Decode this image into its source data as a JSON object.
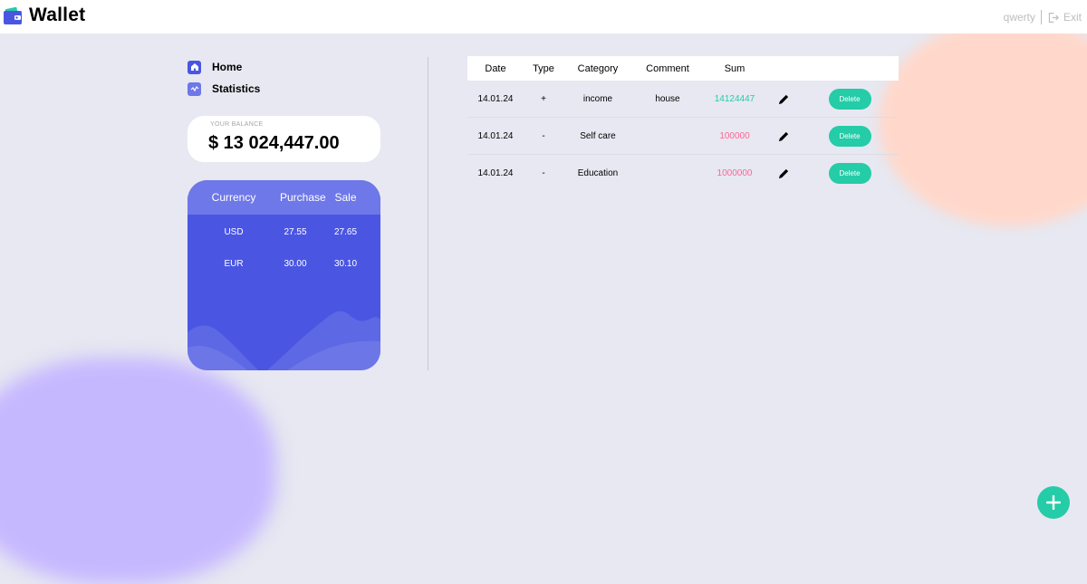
{
  "app": {
    "title": "Wallet"
  },
  "user": {
    "name": "qwerty",
    "exit_label": "Exit"
  },
  "nav": [
    {
      "label": "Home",
      "icon": "home-icon",
      "active": true
    },
    {
      "label": "Statistics",
      "icon": "statistics-icon",
      "active": false
    }
  ],
  "balance": {
    "label": "YOUR BALANCE",
    "value": "$ 13 024,447.00"
  },
  "currency": {
    "headers": [
      "Currency",
      "Purchase",
      "Sale"
    ],
    "rows": [
      {
        "currency": "USD",
        "purchase": "27.55",
        "sale": "27.65"
      },
      {
        "currency": "EUR",
        "purchase": "30.00",
        "sale": "30.10"
      }
    ]
  },
  "transactions": {
    "headers": [
      "Date",
      "Type",
      "Category",
      "Comment",
      "Sum"
    ],
    "rows": [
      {
        "date": "14.01.24",
        "type": "+",
        "category": "income",
        "comment": "house",
        "sum": "14124447",
        "sign": "positive"
      },
      {
        "date": "14.01.24",
        "type": "-",
        "category": "Self care",
        "comment": "",
        "sum": "100000",
        "sign": "negative"
      },
      {
        "date": "14.01.24",
        "type": "-",
        "category": "Education",
        "comment": "",
        "sum": "1000000",
        "sign": "negative"
      }
    ],
    "delete_label": "Delete"
  },
  "colors": {
    "accent": "#4a56e2",
    "positive": "#24cca7",
    "negative": "#ff6596"
  }
}
